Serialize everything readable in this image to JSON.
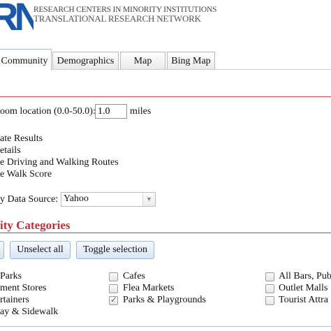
{
  "logo": {
    "mark": "RN",
    "line1": "RESEARCH CENTERS IN MINORITY INSTITUTIONS",
    "line2": "TRANSLATIONAL RESEARCH NETWORK"
  },
  "tabs": [
    {
      "label": "Community",
      "active": true
    },
    {
      "label": "Demographics",
      "active": false
    },
    {
      "label": "Map",
      "active": false
    },
    {
      "label": "Bing Map",
      "active": false
    }
  ],
  "search": {
    "radius_label": "oom location (0.0-50.0):",
    "radius_value": "1.0",
    "radius_unit": "miles"
  },
  "options": [
    "ate Results",
    "etails",
    "e Driving and Walking Routes",
    "e Walk Score"
  ],
  "data_source": {
    "label": "y Data Source:",
    "selected": "Yahoo"
  },
  "categories": {
    "heading": "ity Categories",
    "unselect_all": "Unselect all",
    "toggle_selection": "Toggle selection",
    "col1": [
      "Parks",
      "ment Stores",
      "rtainers",
      "ay & Sidewalk"
    ],
    "col2": [
      {
        "label": "Cafes",
        "checked": false
      },
      {
        "label": "Flea Markets",
        "checked": false
      },
      {
        "label": "Parks & Playgrounds",
        "checked": true
      }
    ],
    "col3": [
      {
        "label": "All Bars, Pub",
        "checked": false
      },
      {
        "label": "Outlet Malls",
        "checked": false
      },
      {
        "label": "Tourist Attra",
        "checked": false
      }
    ]
  },
  "colors": {
    "accent": "#b8323d",
    "brand": "#1d57a8"
  }
}
